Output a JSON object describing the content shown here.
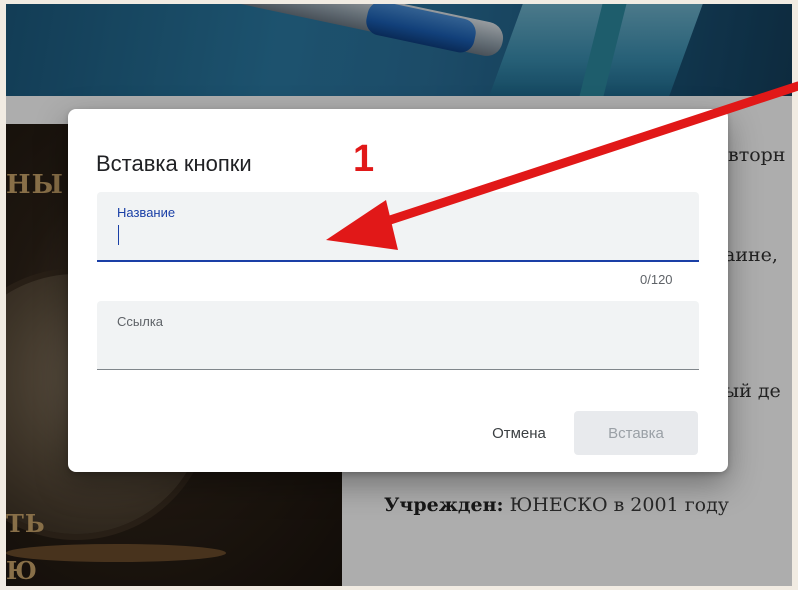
{
  "background_article": {
    "side_words": [
      "НЫ",
      "ТЬ",
      "Ю"
    ],
    "lines": [
      "вторн",
      "аине,",
      "ый де"
    ],
    "footer_label": "Учрежден:",
    "footer_text": " ЮНЕСКО в 2001 году"
  },
  "dialog": {
    "title": "Вставка кнопки",
    "name_field": {
      "label": "Название",
      "value": "",
      "counter": "0/120"
    },
    "link_field": {
      "label": "Ссылка",
      "value": ""
    },
    "cancel_label": "Отмена",
    "insert_label": "Вставка"
  },
  "annotation": {
    "number": "1",
    "color": "#e11818"
  },
  "colors": {
    "accent": "#1a3fa6",
    "field_bg": "#f1f3f4"
  }
}
